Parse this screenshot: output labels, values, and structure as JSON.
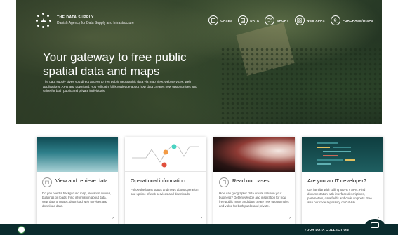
{
  "brand": {
    "name": "THE DATA SUPPLY",
    "subtitle": "Danish Agency for Data Supply and Infrastructure"
  },
  "nav": [
    {
      "label": "CASES",
      "icon": "document-icon"
    },
    {
      "label": "DATA",
      "icon": "list-icon"
    },
    {
      "label": "SHORT",
      "icon": "map-icon"
    },
    {
      "label": "WEB APPS",
      "icon": "grid-icon"
    },
    {
      "label": "PURCHASE/DISPS",
      "icon": "user-icon"
    }
  ],
  "hero": {
    "title_line1": "Your gateway to free public",
    "title_line2": "spatial data and maps",
    "description": "The data supply gives you direct access to free public geographic data via map view, web services, web applications, APIs and download. You will gain full knowledge about how data creates new opportunities and value for both public and private individuals."
  },
  "cards": [
    {
      "title": "View and retrieve data",
      "text": "Do you need a background map, elevation curves, buildings or roads. Find information about data, view data on maps, download web services and download data.",
      "icon": "folder-icon"
    },
    {
      "title": "Operational information",
      "text": "Follow the latest status and news about operation and uptime of web services and downloads.",
      "icon": "status-icon"
    },
    {
      "title": "Read our cases",
      "text": "How can geographic data create value in your business? Get knowledge and inspiration for how free public maps and data create new opportunities and value for both public and private.",
      "icon": "document-icon"
    },
    {
      "title": "Are you an IT developer?",
      "text": "Get familiar with calling SDFE's APIs. Find documentation with interface descriptions, parameters, data fields and code snippets. See also our code repository on GitHub.",
      "icon": "code-icon"
    }
  ],
  "bottom_bar": {
    "collection_label": "YOUR DATA COLLECTION"
  }
}
